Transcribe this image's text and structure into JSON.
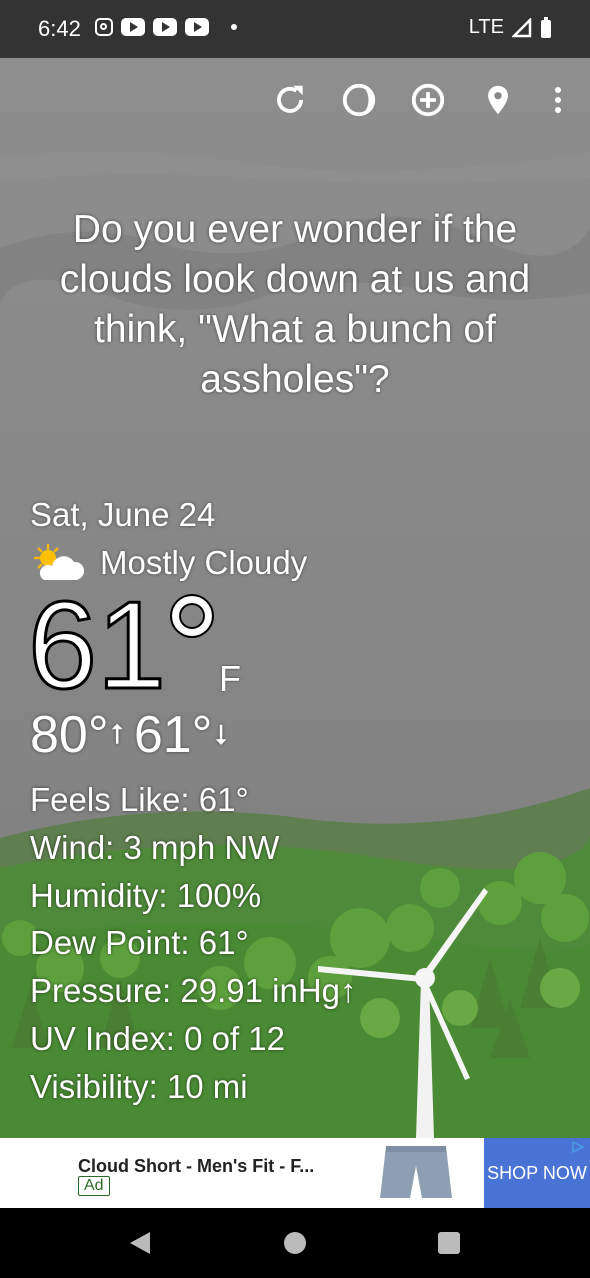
{
  "status_bar": {
    "time": "6:42",
    "network": "LTE"
  },
  "toolbar": {
    "icons": [
      "refresh-icon",
      "theme-icon",
      "add-location-icon",
      "location-pin-icon",
      "more-vert-icon"
    ]
  },
  "quote": "Do you ever wonder if the clouds look down at us and think, \"What a bunch of assholes\"?",
  "weather": {
    "date": "Sat, June 24",
    "condition": "Mostly Cloudy",
    "condition_icon": "partly-cloudy-icon",
    "temperature": "61",
    "unit": "F",
    "high": "80°",
    "low": "61°",
    "details": [
      {
        "label": "Feels Like:",
        "value": "61°"
      },
      {
        "label": "Wind:",
        "value": "3 mph NW"
      },
      {
        "label": "Humidity:",
        "value": "100%"
      },
      {
        "label": "Dew Point:",
        "value": "61°"
      },
      {
        "label": "Pressure:",
        "value": "29.91 inHg↑"
      },
      {
        "label": "UV Index:",
        "value": "0 of 12"
      },
      {
        "label": "Visibility:",
        "value": "10 mi"
      }
    ]
  },
  "ad": {
    "title": "Cloud Short - Men's Fit - F...",
    "badge": "Ad",
    "cta": "SHOP NOW"
  },
  "colors": {
    "sky": "#888888",
    "grass": "#4f8a3a",
    "ad_button": "#4a73d6"
  }
}
